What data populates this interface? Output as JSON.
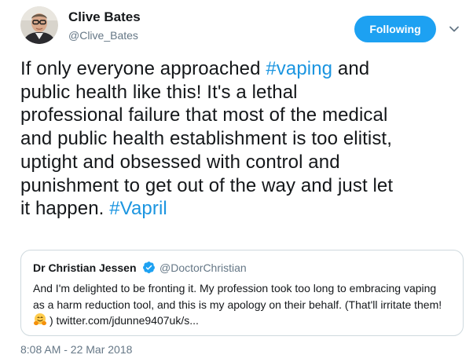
{
  "author": {
    "name": "Clive Bates",
    "handle": "@Clive_Bates"
  },
  "follow_button": {
    "label": "Following",
    "color": "#1da1f2"
  },
  "tweet": {
    "lines": [
      [
        "If only everyone approached ",
        "#vaping",
        " and"
      ],
      [
        "public health like this! It's a lethal"
      ],
      [
        "professional failure that most of the medical"
      ],
      [
        "and public health establishment is too elitist,"
      ],
      [
        "uptight and obsessed with control and"
      ],
      [
        "punishment to get out of the way and just let"
      ],
      [
        "it happen. ",
        "#Vapril"
      ]
    ],
    "hashtag_color": "#1b95e0"
  },
  "quoted_tweet": {
    "author_name": "Dr Christian Jessen",
    "author_handle": "@DoctorChristian",
    "verified_icon": "verified-badge-icon",
    "lines": [
      "And I'm delighted to be fronting it. My profession took too long to embracing vaping",
      "as a harm reduction tool, and this is my apology on their behalf. (That'll irritate them!",
      ") twitter.com/jdunne9407uk/s..."
    ],
    "emoji_icon": "hugging-face-icon"
  },
  "timestamp": "8:08 AM - 22 Mar 2018",
  "icons": {
    "more": "chevron-down-icon",
    "avatar": "avatar-photo"
  }
}
